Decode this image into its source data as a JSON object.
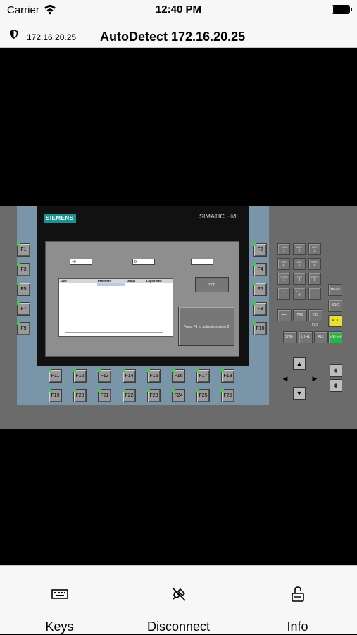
{
  "status_bar": {
    "carrier": "Carrier",
    "time": "12:40 PM"
  },
  "nav": {
    "ip": "172.16.20.25",
    "title": "AutoDetect 172.16.20.25"
  },
  "hmi": {
    "brand": "SIEMENS",
    "model": "SIMATIC HMI",
    "left_keys": [
      "F1",
      "F3",
      "F5",
      "F7",
      "F9"
    ],
    "right_keys": [
      "F2",
      "F4",
      "F6",
      "F8",
      "F10"
    ],
    "bottom_keys_row1": [
      "F11",
      "F12",
      "F13",
      "F14",
      "F15",
      "F16",
      "F17",
      "F18"
    ],
    "bottom_keys_row2": [
      "F19",
      "F20",
      "F21",
      "F22",
      "F23",
      "F24",
      "F25",
      "F26"
    ],
    "screen": {
      "field1_value": "+0",
      "field2_value": "0",
      "field3_value": "",
      "table_columns": [
        "User",
        "Password",
        "Group",
        "Logoff time"
      ],
      "stop_label": "stop",
      "press_label": "Press F1 to activate screen 2"
    },
    "keypad": [
      {
        "top": "- 'ABC",
        "main": "1"
      },
      {
        "top": "ABC",
        "main": "2"
      },
      {
        "top": "DEF",
        "main": "3"
      },
      {
        "top": "GHI",
        "main": "4"
      },
      {
        "top": "JKL",
        "main": "5"
      },
      {
        "top": "MNO",
        "main": "6"
      },
      {
        "top": "PQRS",
        "main": "7"
      },
      {
        "top": "TUV",
        "main": "8"
      },
      {
        "top": "WXYZ",
        "main": "9"
      },
      {
        "top": "",
        "main": "-"
      },
      {
        "top": "+ - . ,",
        "main": "0"
      },
      {
        "top": "",
        "main": "."
      }
    ],
    "special_keys": {
      "help": "HELP",
      "esc": "ESC",
      "ack": "ACK",
      "enter": "ENTER",
      "backspace": "⟵",
      "tab": "TAB",
      "ins_del": "INS DEL",
      "shift": "SHIFT",
      "ctrl": "CTRL",
      "alt": "ALT"
    },
    "arrows": {
      "up": "▲",
      "down": "▼",
      "left": "◀",
      "right": "▶",
      "page_up": "⇞",
      "page_down": "⇟"
    }
  },
  "tabs": [
    {
      "label": "Keys",
      "icon": "keyboard-icon"
    },
    {
      "label": "Disconnect",
      "icon": "disconnect-plug-icon"
    },
    {
      "label": "Info",
      "icon": "unlock-icon"
    }
  ]
}
